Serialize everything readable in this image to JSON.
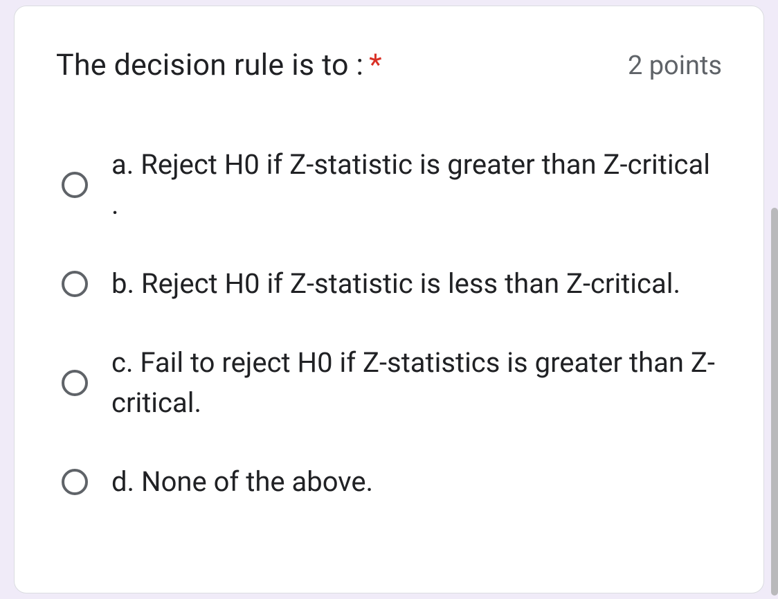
{
  "question": {
    "title": "The decision rule is to :",
    "required_mark": "*",
    "points": "2 points"
  },
  "options": [
    {
      "label": "a. Reject H0 if Z-statistic is greater than Z-critical ."
    },
    {
      "label": "b. Reject H0 if Z-statistic is less than Z-critical."
    },
    {
      "label": "c. Fail to reject H0 if Z-statistics is greater than Z-critical."
    },
    {
      "label": "d. None of the above."
    }
  ]
}
